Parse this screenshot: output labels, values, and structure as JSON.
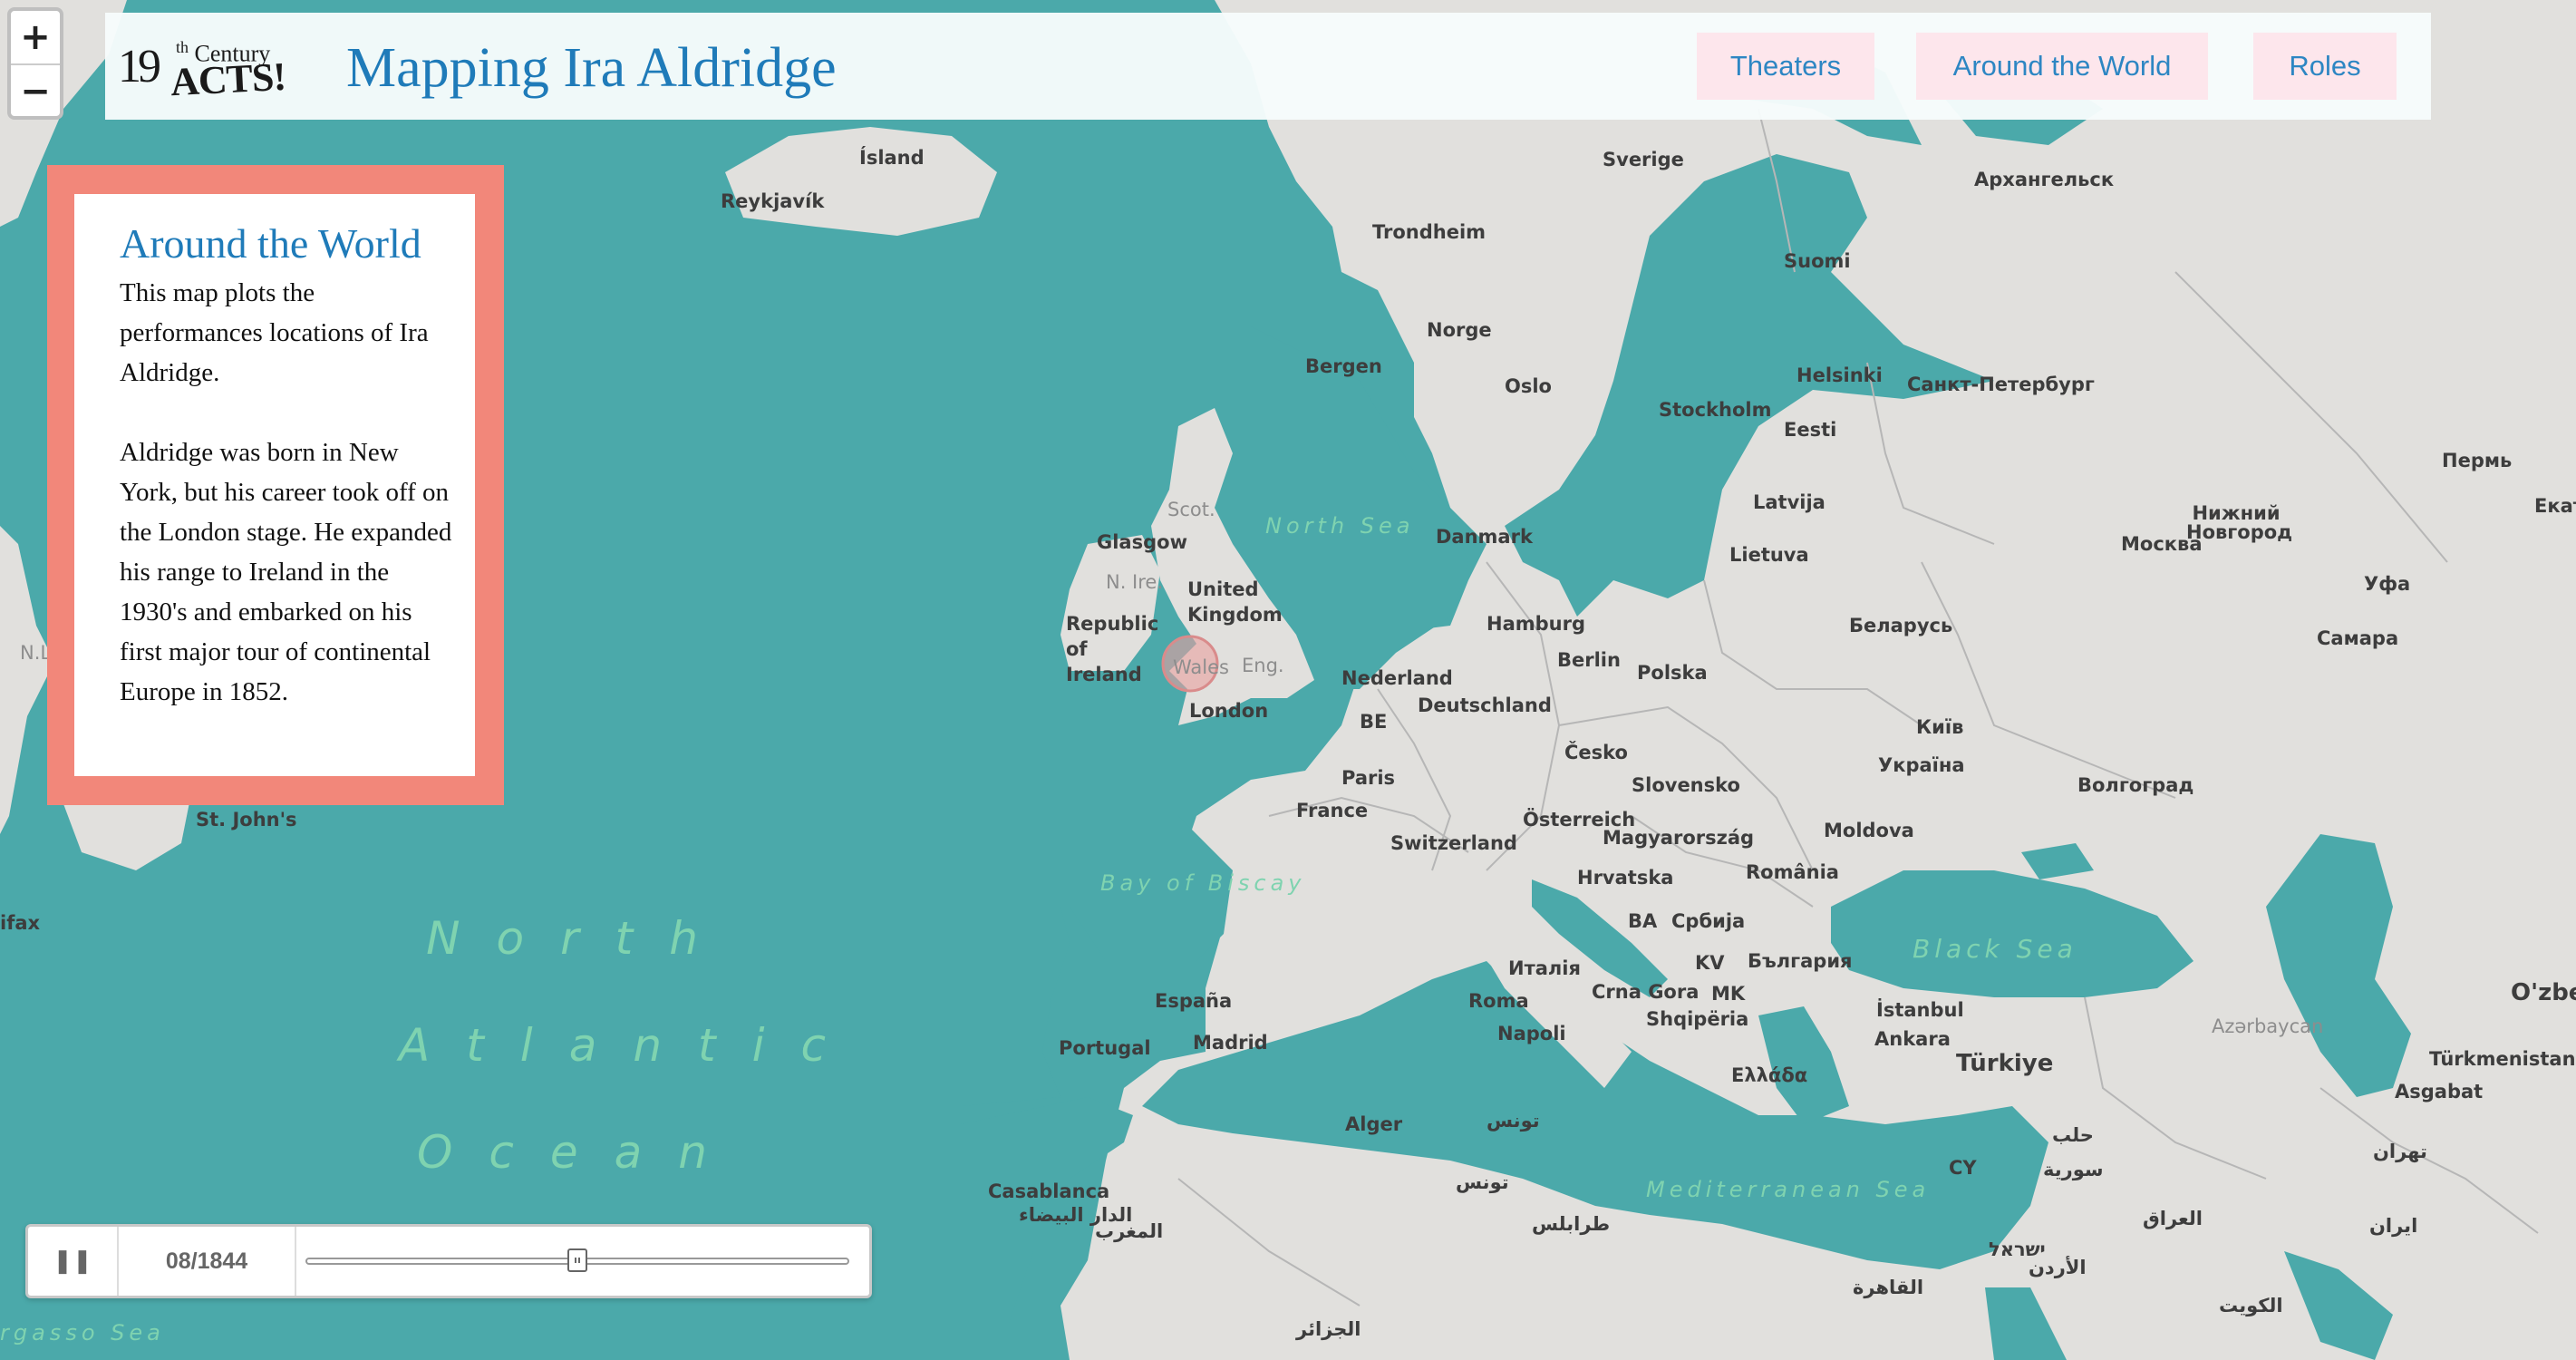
{
  "header": {
    "logo": {
      "number": "19",
      "superscript": "th",
      "century": "Century",
      "acts": "ACTS!"
    },
    "title": "Mapping Ira Aldridge",
    "nav": [
      "Theaters",
      "Around the World",
      "Roles"
    ]
  },
  "zoom": {
    "in": "+",
    "out": "−"
  },
  "info": {
    "heading": "Around the World",
    "paragraphs": [
      "This map plots the performances locations of Ira Aldridge.",
      "Aldridge was born in New York, but his career took off on the London stage. He expanded his range to Ireland in the 1930's and embarked on his first major tour of continental Europe in 1852."
    ]
  },
  "timeline": {
    "play_icon": "pause-icon",
    "date": "08/1844",
    "progress": 0.5
  },
  "colors": {
    "water": "#4ba9aa",
    "land": "#e1e0dd",
    "title": "#1f7bb9",
    "nav_bg": "#fde6ec",
    "panel_border": "#f2877a",
    "marker": "#e9a0a0"
  },
  "map": {
    "places": [
      "Ísland",
      "Reykjavík",
      "Sverige",
      "Архангельск",
      "Trondheim",
      "Suomi",
      "Norge",
      "Bergen",
      "Oslo",
      "Helsinki",
      "Санкт-Петербург",
      "Stockholm",
      "Eesti",
      "Пермь",
      "Екат",
      "Scot.",
      "Glasgow",
      "Danmark",
      "Latvija",
      "Нижний Новгород",
      "Москва",
      "Lietuva",
      "N. Ire.",
      "United Kingdom",
      "Уфа",
      "Republic of Ireland",
      "Hamburg",
      "Беларусь",
      "Самара",
      "Wales",
      "Eng.",
      "Berlin",
      "Polska",
      "Nederland",
      "London",
      "BE",
      "Deutschland",
      "Київ",
      "Česko",
      "Україна",
      "Paris",
      "Slovensko",
      "Волгоград",
      "France",
      "Österreich",
      "Moldova",
      "Magyarország",
      "Switzerland",
      "România",
      "Hrvatska",
      "BA",
      "Србија",
      "Италія",
      "България",
      "KV",
      "Crna Gora",
      "MK",
      "España",
      "Portugal",
      "Madrid",
      "Roma",
      "Napoli",
      "Shqipëria",
      "İstanbul",
      "Ankara",
      "Türkiye",
      "Ελλάδα",
      "Alger",
      "تونس",
      "Casablanca",
      "الدار البيضاء",
      "المغرب",
      "CY",
      "الجزائر",
      "القاهرة",
      "Asgabat",
      "Türkmenistan",
      "O'zbe",
      "Azərbaycan",
      "ایران",
      "العراق",
      "سورية",
      "حلب",
      "تهران",
      "الكويت",
      "ישראל",
      "الأردن",
      "تونس",
      "طرابلس",
      "St. John's",
      "ifax",
      "N.L."
    ],
    "seas": [
      "North Atlantic Ocean",
      "North Sea",
      "Bay of Biscay",
      "Black Sea",
      "Mediterranean Sea",
      "rgasso Sea"
    ]
  }
}
